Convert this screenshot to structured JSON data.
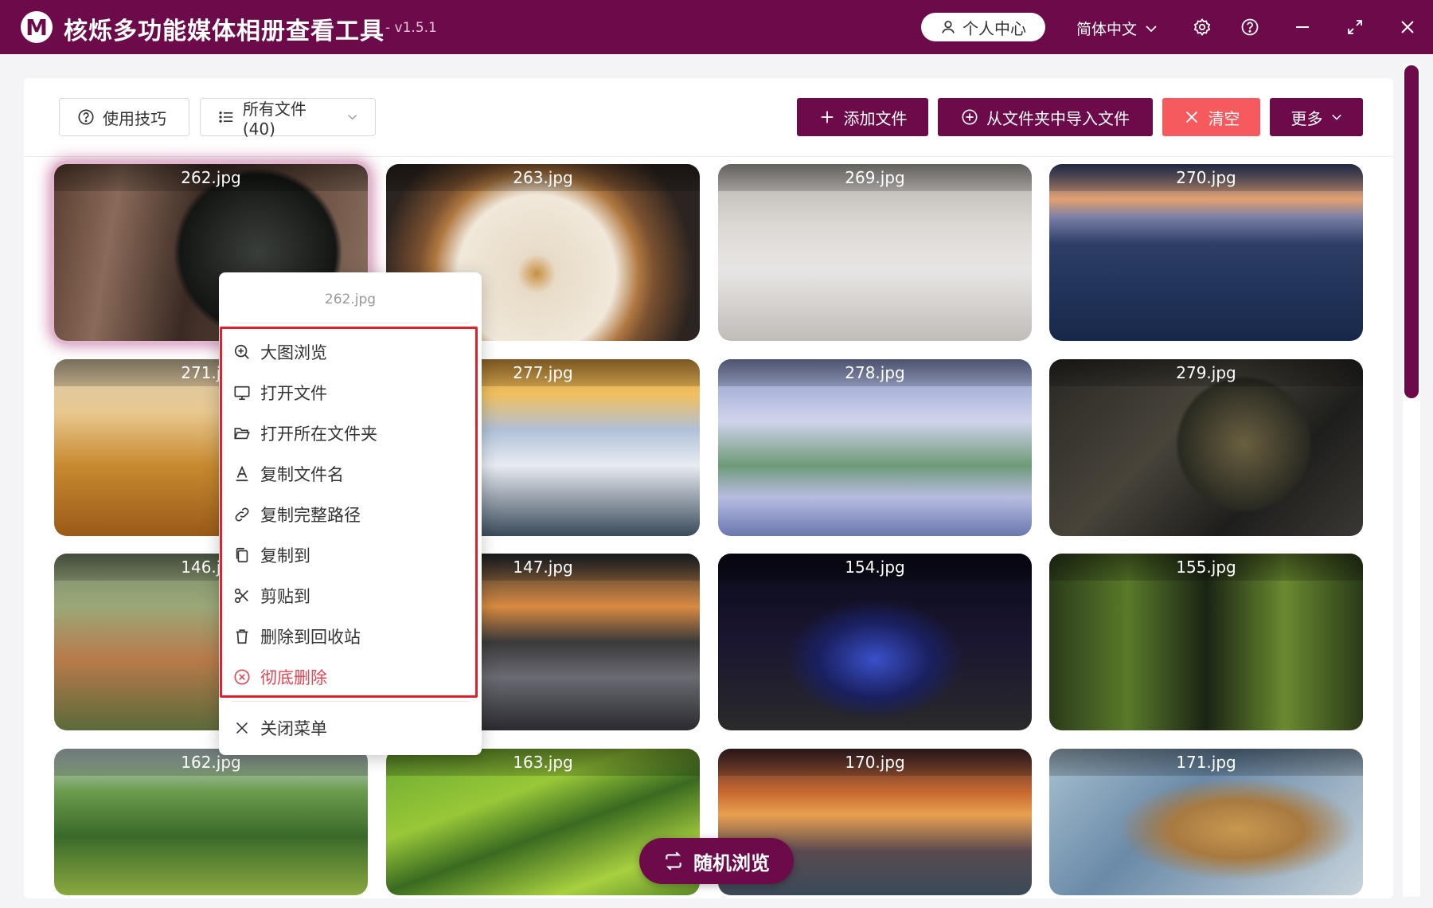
{
  "app": {
    "title": "核烁多功能媒体相册查看工具",
    "version": "- v1.5.1",
    "logo_letter": "M"
  },
  "titlebar": {
    "user_center": "个人中心",
    "language": "简体中文",
    "icons": [
      "settings-icon",
      "help-icon",
      "minimize-icon",
      "maximize-icon",
      "close-icon"
    ]
  },
  "toolbar": {
    "tips": "使用技巧",
    "filter": "所有文件 (40)",
    "add_file": "添加文件",
    "import_folder": "从文件夹中导入文件",
    "clear": "清空",
    "more": "更多"
  },
  "grid": {
    "rows": [
      [
        "262.jpg",
        "263.jpg",
        "269.jpg",
        "270.jpg"
      ],
      [
        "271.jpg",
        "277.jpg",
        "278.jpg",
        "279.jpg"
      ],
      [
        "146.jpg",
        "147.jpg",
        "154.jpg",
        "155.jpg"
      ],
      [
        "162.jpg",
        "163.jpg",
        "170.jpg",
        "171.jpg"
      ]
    ],
    "selected": "262.jpg"
  },
  "context_menu": {
    "header": "262.jpg",
    "items": [
      {
        "label": "大图浏览",
        "icon": "zoom-in-icon"
      },
      {
        "label": "打开文件",
        "icon": "monitor-icon"
      },
      {
        "label": "打开所在文件夹",
        "icon": "folder-open-icon"
      },
      {
        "label": "复制文件名",
        "icon": "text-icon"
      },
      {
        "label": "复制完整路径",
        "icon": "link-icon"
      },
      {
        "label": "复制到",
        "icon": "copy-icon"
      },
      {
        "label": "剪贴到",
        "icon": "scissors-icon"
      },
      {
        "label": "删除到回收站",
        "icon": "trash-icon"
      },
      {
        "label": "彻底删除",
        "icon": "delete-circle-icon"
      }
    ],
    "close": "关闭菜单"
  },
  "random_browse": "随机浏览",
  "colors": {
    "brand": "#6d0a4a",
    "danger": "#f55a5f",
    "danger_text": "#e64551",
    "highlight_box": "#e0202c"
  }
}
